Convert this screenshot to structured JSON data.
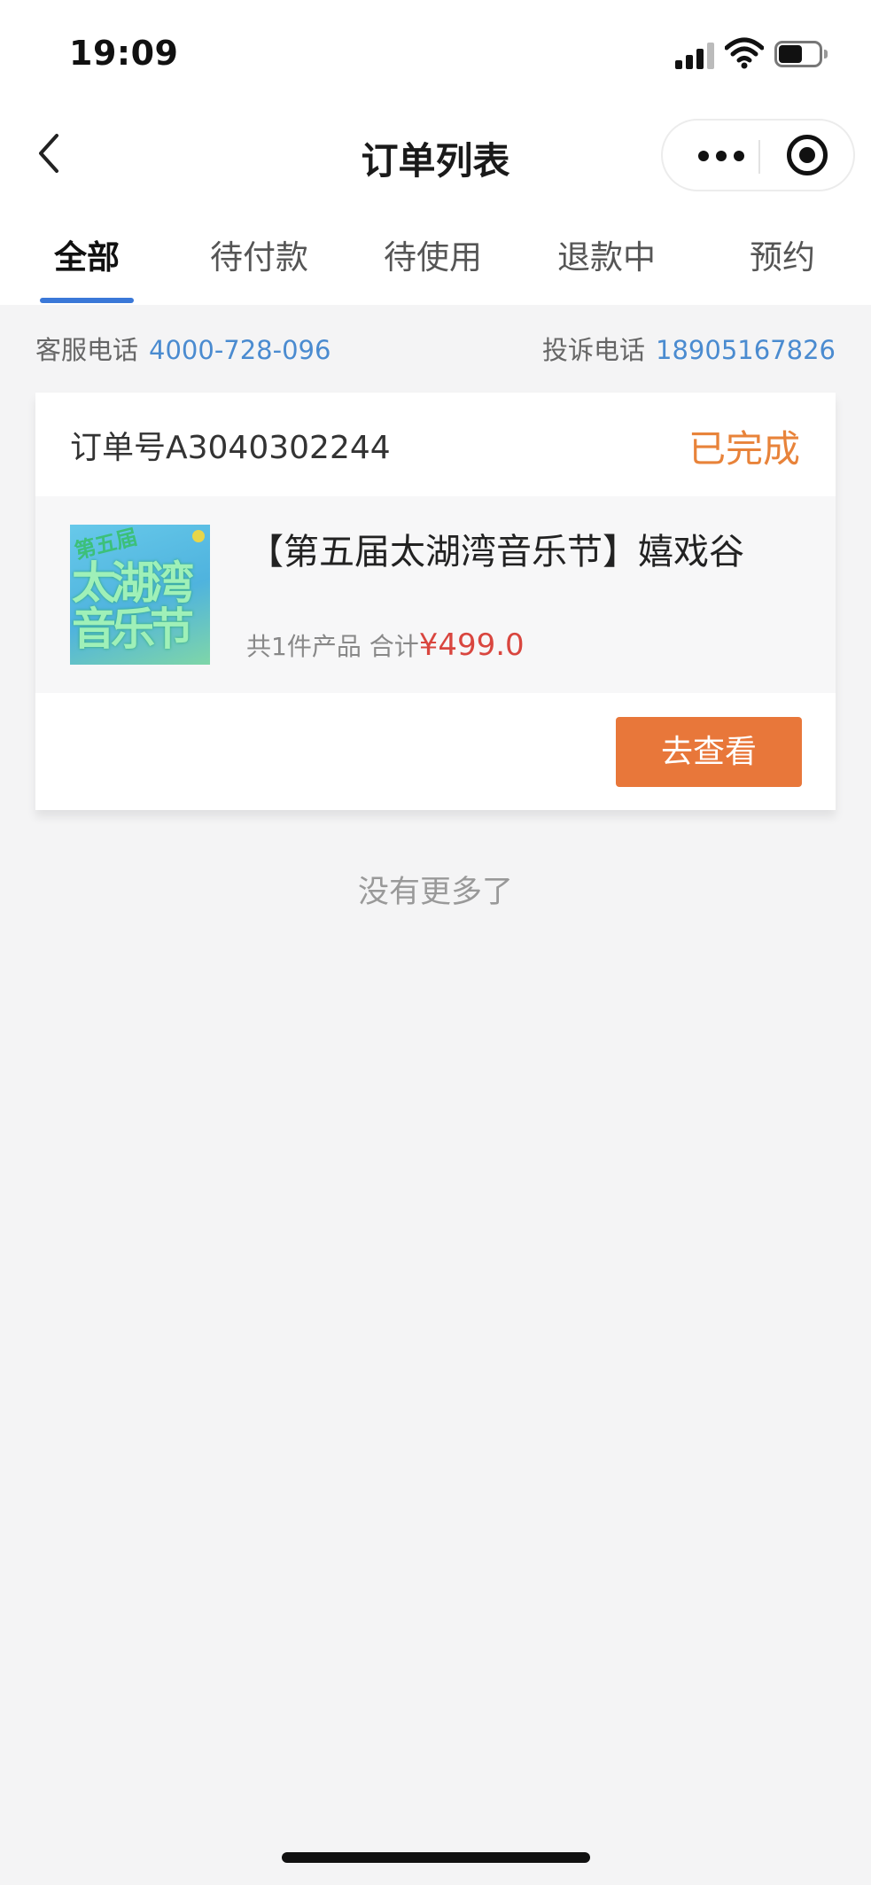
{
  "status_bar": {
    "time": "19:09"
  },
  "nav": {
    "title": "订单列表"
  },
  "tabs": [
    {
      "label": "全部",
      "active": true
    },
    {
      "label": "待付款",
      "active": false
    },
    {
      "label": "待使用",
      "active": false
    },
    {
      "label": "退款中",
      "active": false
    },
    {
      "label": "预约",
      "active": false
    }
  ],
  "contact": {
    "service_label": "客服电话",
    "service_phone": "4000-728-096",
    "complaint_label": "投诉电话",
    "complaint_phone": "18905167826"
  },
  "order": {
    "number": "订单号A3040302244",
    "status": "已完成",
    "product_name": "【第五届太湖湾音乐节】嬉戏谷",
    "summary_prefix": "共1件产品 合计",
    "price": "¥499.0",
    "view_button": "去查看",
    "thumbnail": {
      "badge": "第五届",
      "text": "太湖湾音乐节"
    }
  },
  "footer": {
    "no_more": "没有更多了"
  },
  "colors": {
    "accent_orange": "#e8773a",
    "tab_blue": "#3a78d8",
    "link_blue": "#4a8bd0",
    "price_red": "#d9463f"
  }
}
